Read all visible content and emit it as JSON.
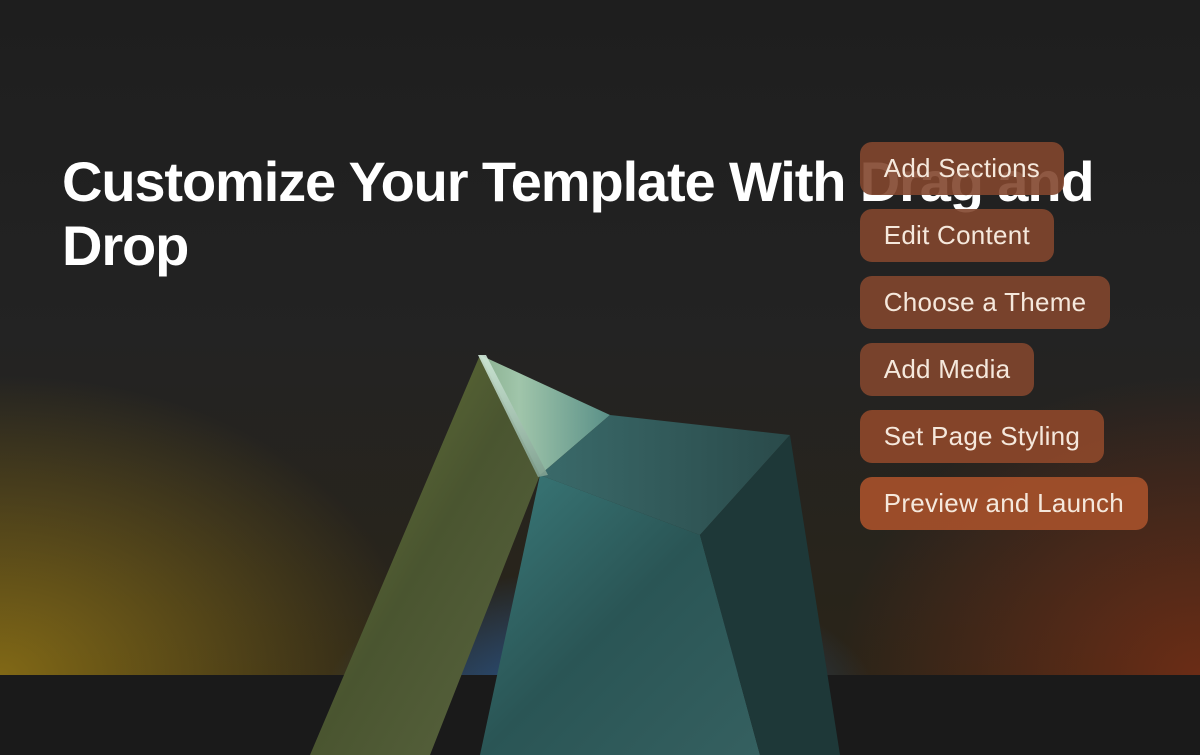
{
  "headline": "Customize Your Template With Drag and Drop",
  "actions": [
    "Add Sections",
    "Edit Content",
    "Choose a Theme",
    "Add Media",
    "Set Page Styling",
    "Preview and Launch"
  ]
}
